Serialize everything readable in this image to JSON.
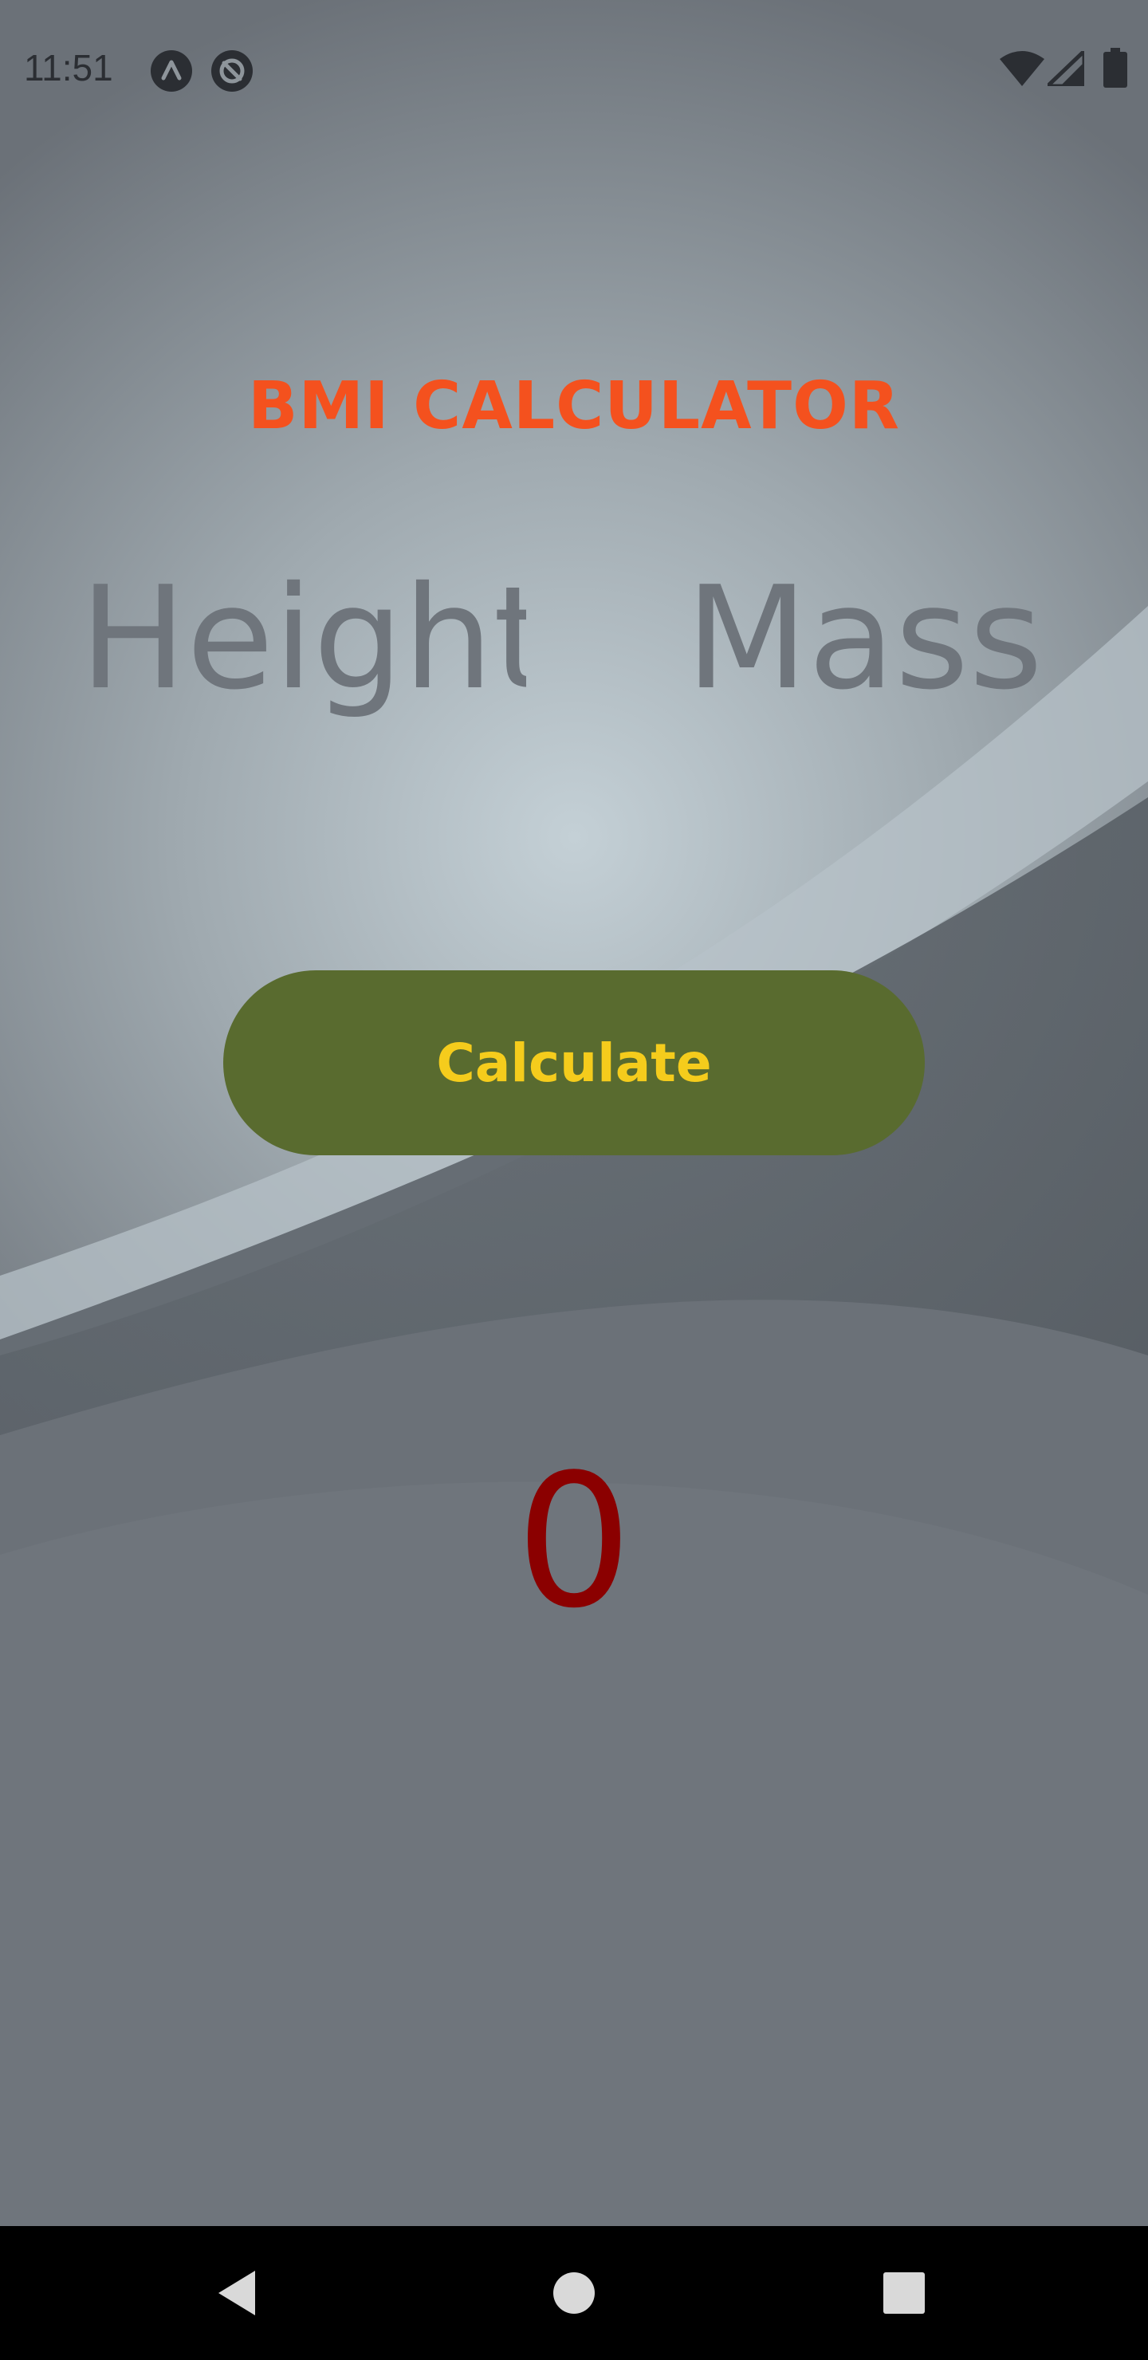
{
  "status_bar": {
    "time": "11:51",
    "left_icons": [
      "app-notification-icon",
      "do-not-disturb-icon"
    ],
    "right_icons": [
      "wifi-icon",
      "cellular-signal-icon",
      "battery-icon"
    ]
  },
  "app": {
    "title": "BMI CALCULATOR",
    "height_input": {
      "placeholder": "Height",
      "value": ""
    },
    "mass_input": {
      "placeholder": "Mass",
      "value": ""
    },
    "calculate_label": "Calculate",
    "result": "0"
  },
  "nav_bar": {
    "buttons": [
      "back-icon",
      "home-icon",
      "recents-icon"
    ]
  },
  "colors": {
    "title": "#f4511e",
    "button_bg": "#596b2f",
    "button_text": "#f5cc1c",
    "result": "#8b0000",
    "placeholder": "#6f757c"
  }
}
